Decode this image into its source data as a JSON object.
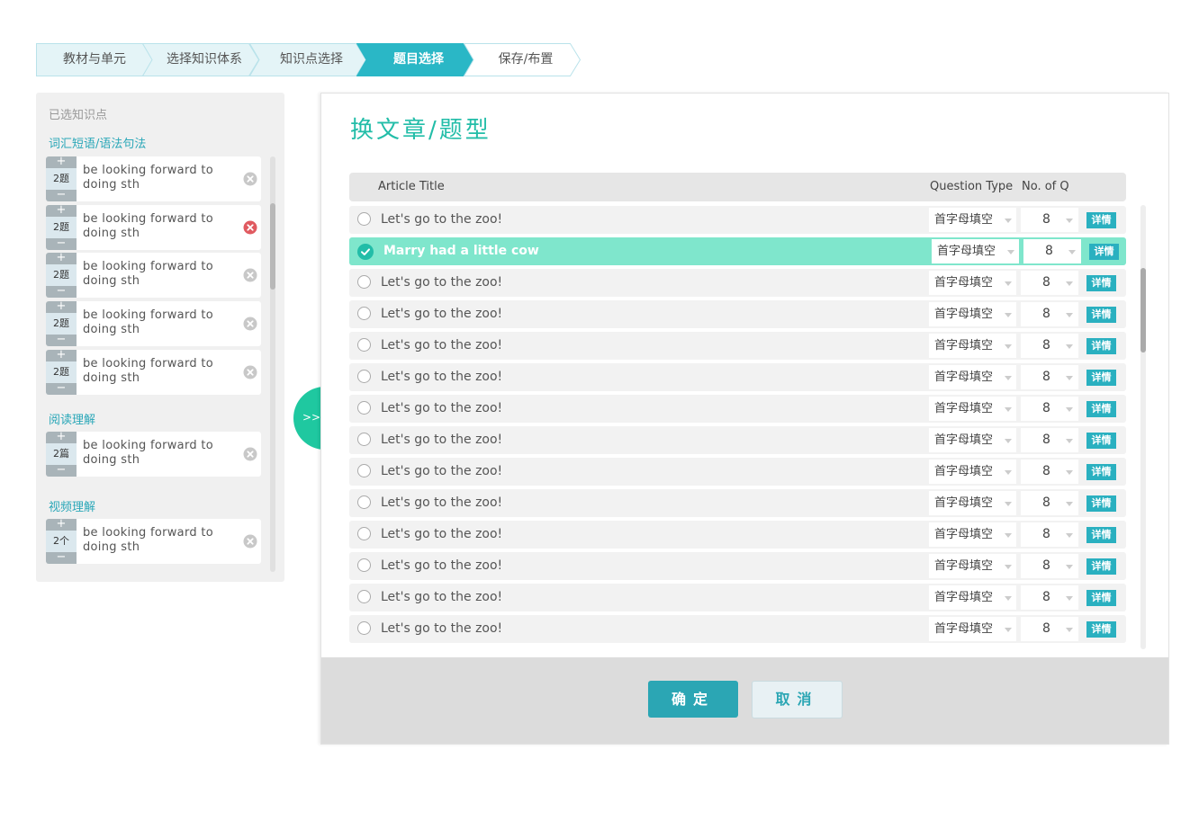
{
  "steps": [
    {
      "label": "教材与单元",
      "active": false
    },
    {
      "label": "选择知识体系",
      "active": false
    },
    {
      "label": "知识点选择",
      "active": false
    },
    {
      "label": "题目选择",
      "active": true
    },
    {
      "label": "保存/布置",
      "active": false
    }
  ],
  "left_panel": {
    "title": "已选知识点",
    "groups": [
      {
        "name": "词汇短语/语法句法",
        "items": [
          {
            "count": "2题",
            "line1": "be looking forward to",
            "line2": "doing sth",
            "remove_state": "normal"
          },
          {
            "count": "2题",
            "line1": "be looking forward to",
            "line2": "doing sth",
            "remove_state": "hover"
          },
          {
            "count": "2题",
            "line1": "be looking forward to",
            "line2": "doing sth",
            "remove_state": "normal"
          },
          {
            "count": "2题",
            "line1": "be looking forward to",
            "line2": "doing sth",
            "remove_state": "normal"
          },
          {
            "count": "2题",
            "line1": "be looking forward to",
            "line2": "doing sth",
            "remove_state": "normal"
          }
        ]
      },
      {
        "name": "阅读理解",
        "items": [
          {
            "count": "2篇",
            "line1": "be looking forward to",
            "line2": "doing sth",
            "remove_state": "normal"
          }
        ]
      },
      {
        "name": "视频理解",
        "items": [
          {
            "count": "2个",
            "line1": "be looking forward to",
            "line2": "doing sth",
            "remove_state": "normal"
          }
        ]
      }
    ],
    "plus": "+",
    "minus": "−"
  },
  "toggle": {
    "label": ">>"
  },
  "dialog": {
    "title": "换文章/题型",
    "columns": {
      "title": "Article Title",
      "type": "Question Type",
      "num": "No. of Q"
    },
    "rows": [
      {
        "title": "Let's go to the zoo!",
        "type": "首字母填空",
        "num": "8",
        "detail": "详情",
        "selected": false
      },
      {
        "title": "Marry had a little cow",
        "type": "首字母填空",
        "num": "8",
        "detail": "详情",
        "selected": true
      },
      {
        "title": "Let's go to the zoo!",
        "type": "首字母填空",
        "num": "8",
        "detail": "详情",
        "selected": false
      },
      {
        "title": "Let's go to the zoo!",
        "type": "首字母填空",
        "num": "8",
        "detail": "详情",
        "selected": false
      },
      {
        "title": "Let's go to the zoo!",
        "type": "首字母填空",
        "num": "8",
        "detail": "详情",
        "selected": false
      },
      {
        "title": "Let's go to the zoo!",
        "type": "首字母填空",
        "num": "8",
        "detail": "详情",
        "selected": false
      },
      {
        "title": "Let's go to the zoo!",
        "type": "首字母填空",
        "num": "8",
        "detail": "详情",
        "selected": false
      },
      {
        "title": "Let's go to the zoo!",
        "type": "首字母填空",
        "num": "8",
        "detail": "详情",
        "selected": false
      },
      {
        "title": "Let's go to the zoo!",
        "type": "首字母填空",
        "num": "8",
        "detail": "详情",
        "selected": false
      },
      {
        "title": "Let's go to the zoo!",
        "type": "首字母填空",
        "num": "8",
        "detail": "详情",
        "selected": false
      },
      {
        "title": "Let's go to the zoo!",
        "type": "首字母填空",
        "num": "8",
        "detail": "详情",
        "selected": false
      },
      {
        "title": "Let's go to the zoo!",
        "type": "首字母填空",
        "num": "8",
        "detail": "详情",
        "selected": false
      },
      {
        "title": "Let's go to the zoo!",
        "type": "首字母填空",
        "num": "8",
        "detail": "详情",
        "selected": false
      },
      {
        "title": "Let's go to the zoo!",
        "type": "首字母填空",
        "num": "8",
        "detail": "详情",
        "selected": false
      }
    ],
    "ok_label": "确定",
    "cancel_label": "取消"
  },
  "colors": {
    "accent": "#22bda8",
    "step_active": "#2ab7c6",
    "step_bg": "#e4f4f7",
    "selected_row": "#7fe6cc",
    "detail_badge": "#2ab0c0",
    "ok_button": "#2ba6b4",
    "remove_hover": "#e05a60"
  }
}
